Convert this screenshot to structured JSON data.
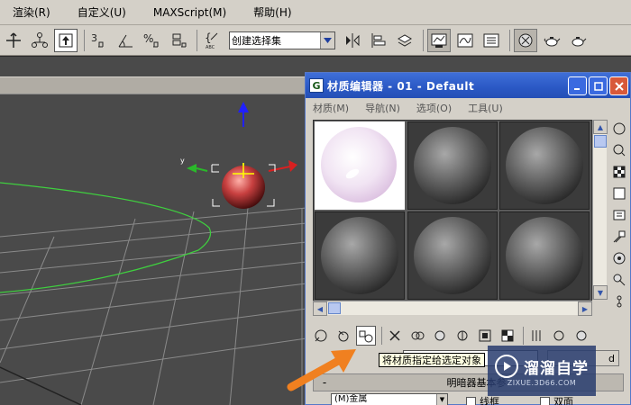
{
  "menubar": {
    "items": [
      "渲染(R)",
      "自定义(U)",
      "MAXScript(M)",
      "帮助(H)"
    ]
  },
  "toolbar": {
    "selection_set_value": "创建选择集",
    "icons": [
      "select-move-icon",
      "hierarchy-icon",
      "select-object-icon",
      "snap-3d-icon",
      "angle-snap-icon",
      "percent-snap-icon",
      "spinner-snap-icon",
      "named-selection-icon",
      "mirror-icon",
      "align-icon",
      "layer-icon",
      "material-editor-icon",
      "curve-editor-icon",
      "render-setup-icon",
      "render-icon",
      "teapot-render-icon",
      "quick-render-icon"
    ]
  },
  "material_editor": {
    "title": "材质编辑器 - 01 - Default",
    "menu": [
      "材质(M)",
      "导航(N)",
      "选项(O)",
      "工具(U)"
    ],
    "window_buttons": [
      "minimize",
      "maximize",
      "close"
    ],
    "slots": [
      {
        "label": "slot-1",
        "active": true,
        "color": "#f2e8f4"
      },
      {
        "label": "slot-2",
        "active": false,
        "color": "#808080"
      },
      {
        "label": "slot-3",
        "active": false,
        "color": "#808080"
      },
      {
        "label": "slot-4",
        "active": false,
        "color": "#808080"
      },
      {
        "label": "slot-5",
        "active": false,
        "color": "#808080"
      },
      {
        "label": "slot-6",
        "active": false,
        "color": "#808080"
      }
    ],
    "tooltip": "将材质指定给选定对象",
    "rollout_title": "明暗器基本参",
    "shader_value": "(M)金属",
    "wireframe_label": "线框",
    "two_sided_label": "双面",
    "name_button": "d"
  },
  "watermark": {
    "brand": "溜溜自学",
    "url": "ZIXUE.3D66.COM"
  },
  "colors": {
    "ui_gray": "#d4d0c8",
    "title_blue": "#2a58c4",
    "viewport_gray": "#4a4a4a",
    "grid": "#8a8a8a",
    "spline_green": "#3fcf3f",
    "sphere_red": "#c84040",
    "arrow_orange": "#f08020"
  }
}
